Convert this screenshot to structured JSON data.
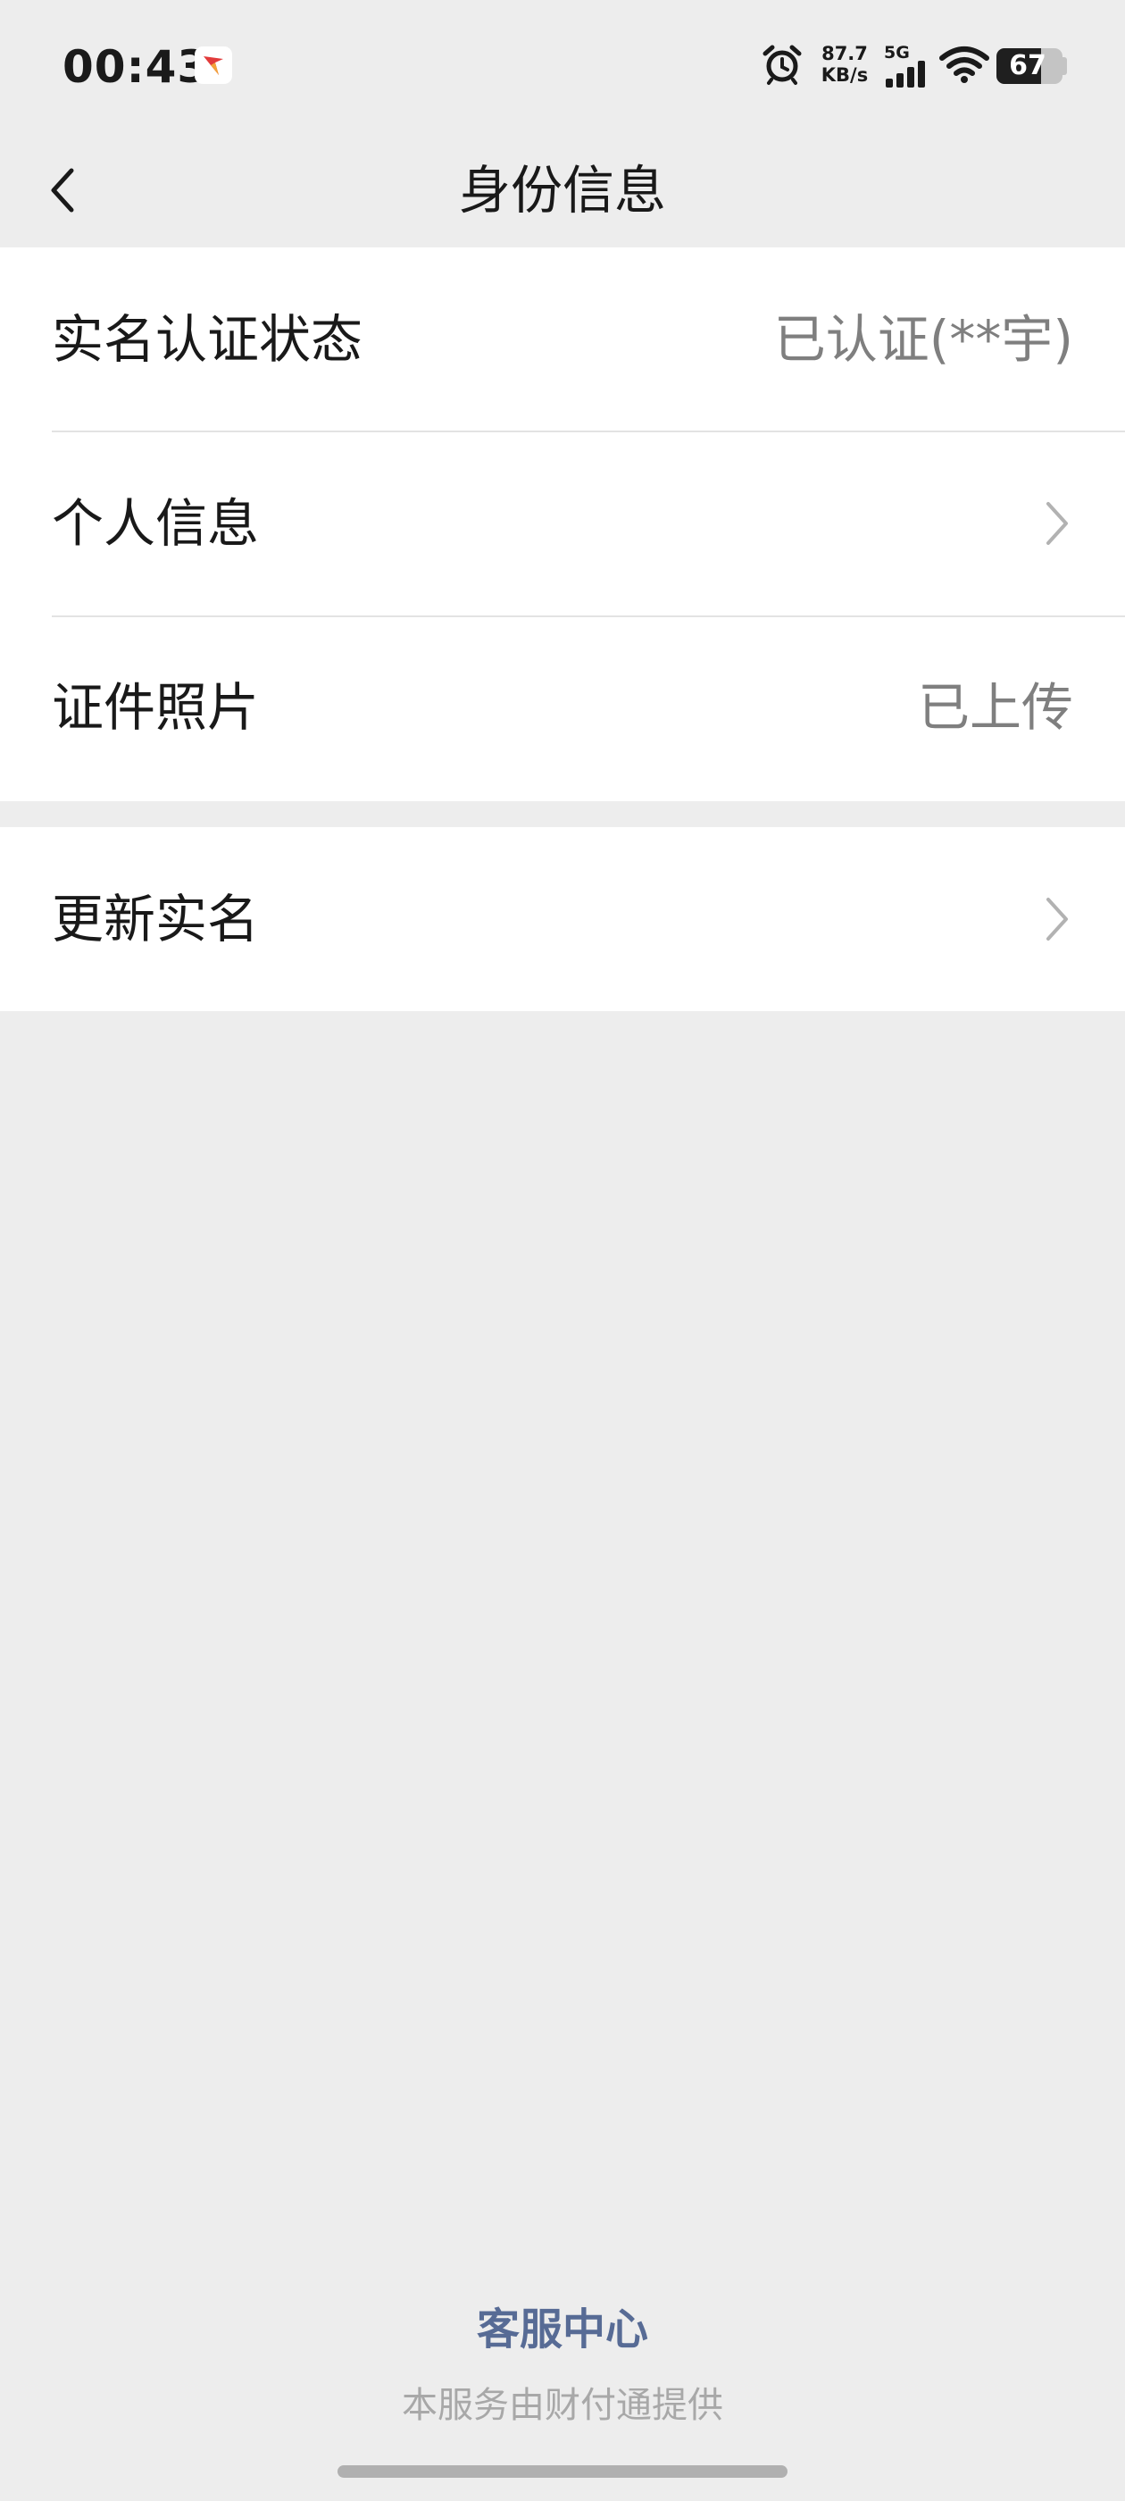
{
  "status_bar": {
    "time": "00:43",
    "net_speed_value": "87.7",
    "net_speed_unit": "KB/s",
    "signal_label": "5G",
    "battery_level": "67",
    "battery_fraction": 0.67
  },
  "nav": {
    "title": "身份信息",
    "back_icon": "chevron-left-icon"
  },
  "rows": [
    {
      "label": "实名认证状态",
      "value": "已认证(**宇)"
    },
    {
      "label": "个人信息",
      "icon": "chevron-right-icon"
    },
    {
      "label": "证件照片",
      "value": "已上传"
    },
    {
      "label": "更新实名",
      "icon": "chevron-right-icon"
    }
  ],
  "footer": {
    "link": "客服中心",
    "note": "本服务由财付通提供"
  },
  "colors": {
    "background": "#ededed",
    "card": "#ffffff",
    "link": "#576b95",
    "secondary_text": "#7f7f7f"
  }
}
